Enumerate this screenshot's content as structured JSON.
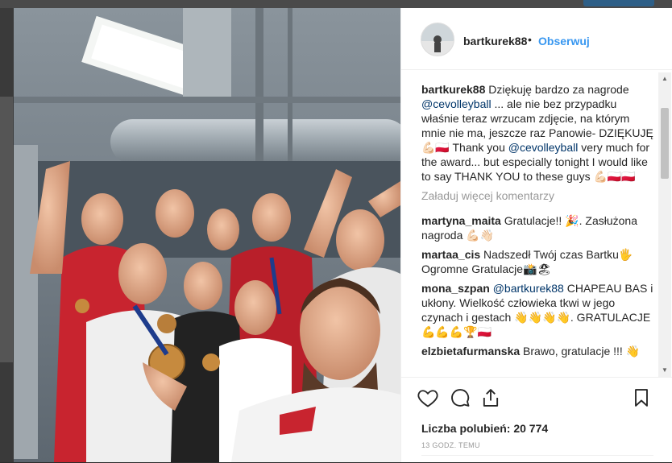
{
  "post": {
    "author": "bartkurek88",
    "dot": "•",
    "follow_label": "Obserwuj",
    "caption": {
      "user": "bartkurek88",
      "parts": [
        " Dziękuję bardzo za nagrode ",
        "@cevolleyball",
        " ... ale nie bez przypadku właśnie teraz wrzucam zdjęcie, na którym mnie nie ma, jeszcze raz Panowie- DZIĘKUJĘ 💪🏻🇵🇱 Thank you ",
        "@cevolleyball",
        " very much for the award... but especially tonight I would like to say THANK YOU to these guys 💪🏻🇵🇱🇵🇱"
      ]
    },
    "load_more": "Załaduj więcej komentarzy",
    "comments": [
      {
        "user": "martyna_maita",
        "text": " Gratulacje!! 🎉. Zasłużona nagroda 💪🏻👋🏻"
      },
      {
        "user": "martaa_cis",
        "text": " Nadszedł Twój czas Bartku🖐 Ogromne Gratulacje📸🏖"
      },
      {
        "user": "mona_szpan",
        "mention": "@bartkurek88",
        "text": " CHAPEAU BAS i ukłony. Wielkość człowieka tkwi w jego czynach i gestach 👋👋👋👋. GRATULACJE 💪💪💪🏆🇵🇱"
      },
      {
        "user": "elzbietafurmanska",
        "text": " Brawo, gratulacje !!! 👋"
      }
    ],
    "likes": "Liczba polubień: 20 774",
    "time": "13 GODZ. TEMU"
  },
  "icons": {
    "like": "heart-icon",
    "comment": "comment-icon",
    "share": "share-icon",
    "save": "bookmark-icon"
  },
  "colors": {
    "accent": "#3897f0",
    "mention": "#003569",
    "text": "#262626",
    "muted": "#999999"
  }
}
